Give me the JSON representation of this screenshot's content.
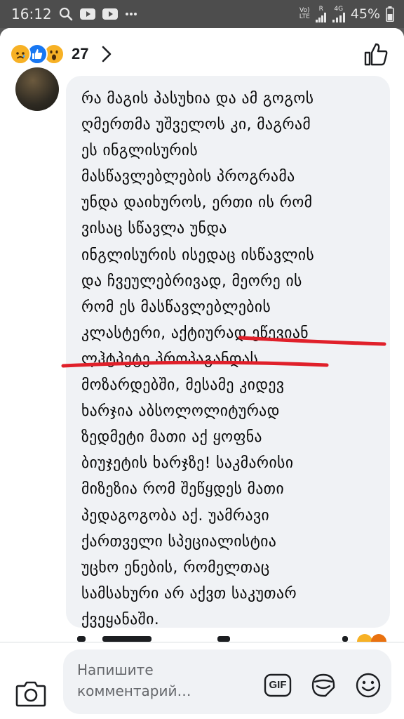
{
  "status_bar": {
    "time": "16:12",
    "signal_label_1": "Vo)",
    "signal_label_2": "LTE",
    "r_label": "R",
    "net_label": "4G",
    "battery": "45%",
    "icons": [
      "search-icon",
      "youtube-icon",
      "youtube-icon",
      "more-dots-icon",
      "volte-icon",
      "signal-icon",
      "signal-icon",
      "battery-icon"
    ]
  },
  "reactions": {
    "icons": [
      "sad-reaction-icon",
      "like-reaction-icon",
      "wow-reaction-icon"
    ],
    "count": "27"
  },
  "comment": {
    "lines": [
      "რა მაგის პასუხია და ამ გოგოს",
      "ღმერთმა უშველოს კი, მაგრამ",
      "ეს ინგლისურის",
      "მასწავლებლების პროგრამა",
      "უნდა დაიხუროს,  ერთი ის რომ",
      "ვისაც სწავლა უნდა",
      "ინგლისურის ისედაც ისწავლის",
      "და ჩვეულებრივად, მეორე ის",
      "რომ ეს მასწავლებლების",
      "კლასტერი, აქტიურად ეწევიან",
      "ლჰტპეტე პროპაგანდას",
      "მოზარდებში, მესამე კიდევ",
      "ხარჯია აბსოლოლიტურად",
      "ზედმეტი  მათი აქ ყოფნა",
      "ბიუჯეტის ხარჯზე!  საკმარისი",
      "მიზეზია რომ შეწყდეს მათი",
      "პედაგოგობა აქ.   უამრავი",
      "ქართველი სპეციალისტია",
      "უცხო ენების, რომელთაც",
      "სამსახური  არ აქვთ საკუთარ",
      "ქვეყანაში."
    ],
    "annotation_color": "#e0202a"
  },
  "composer": {
    "placeholder_line1": "Напишите",
    "placeholder_line2": "комментарий…",
    "gif_label": "GIF"
  },
  "colors": {
    "accent": "#1877f2",
    "bubble": "#f0f2f5",
    "status_bar": "#4d4d4d"
  }
}
